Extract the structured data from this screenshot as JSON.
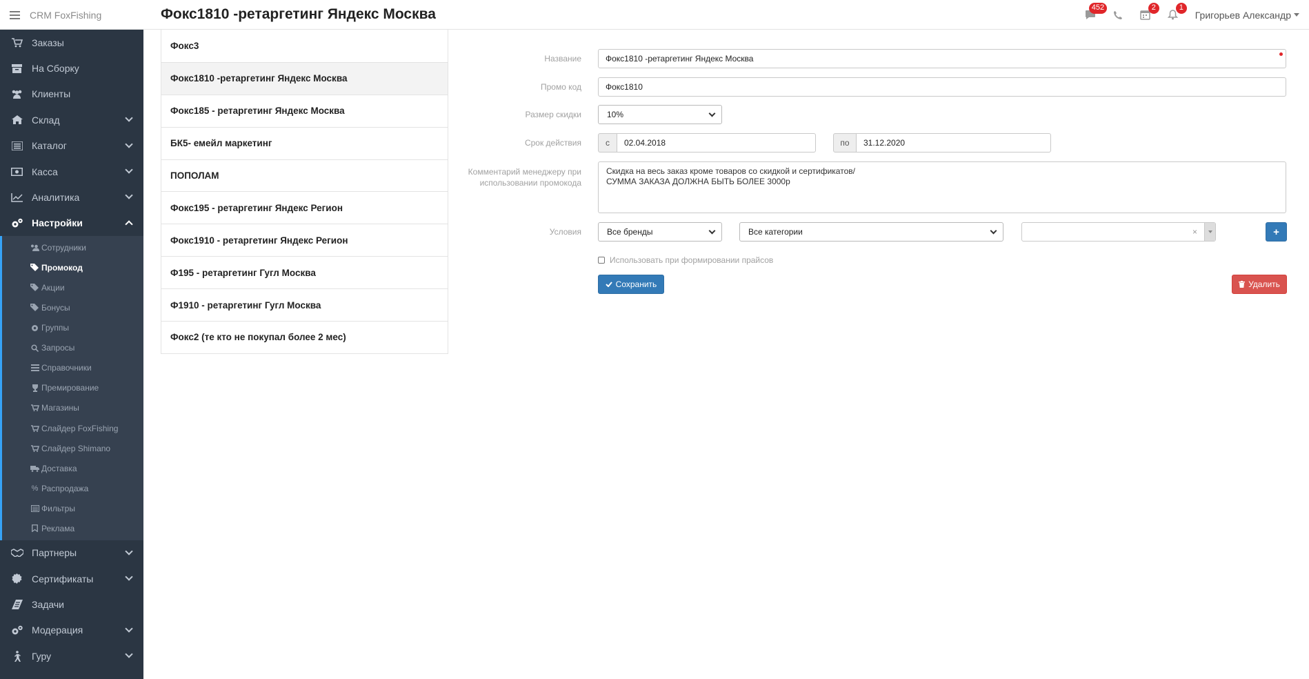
{
  "app": {
    "brand": "CRM FoxFishing",
    "page_title": "Фокс1810 -ретаргетинг Яндекс Москва"
  },
  "header": {
    "messages_count": "452",
    "calendar_count": "2",
    "notifications_count": "1",
    "user_name": "Григорьев Александр"
  },
  "sidebar": {
    "items": [
      {
        "label": "Заказы",
        "icon": "cart-icon"
      },
      {
        "label": "На Сборку",
        "icon": "box-icon"
      },
      {
        "label": "Клиенты",
        "icon": "users-icon"
      },
      {
        "label": "Склад",
        "icon": "home-icon"
      },
      {
        "label": "Каталог",
        "icon": "list-icon"
      },
      {
        "label": "Касса",
        "icon": "money-icon"
      },
      {
        "label": "Аналитика",
        "icon": "chart-icon"
      },
      {
        "label": "Настройки",
        "icon": "cogs-icon"
      }
    ],
    "sub_items": [
      {
        "label": "Сотрудники",
        "icon": "users-icon"
      },
      {
        "label": "Промокод",
        "icon": "tags-icon"
      },
      {
        "label": "Акции",
        "icon": "tags-icon"
      },
      {
        "label": "Бонусы",
        "icon": "tags-icon"
      },
      {
        "label": "Группы",
        "icon": "gear-icon"
      },
      {
        "label": "Запросы",
        "icon": "search-icon"
      },
      {
        "label": "Справочники",
        "icon": "list-icon"
      },
      {
        "label": "Премирование",
        "icon": "trophy-icon"
      },
      {
        "label": "Магазины",
        "icon": "cart-icon"
      },
      {
        "label": "Слайдер FoxFishing",
        "icon": "cart-icon"
      },
      {
        "label": "Слайдер Shimano",
        "icon": "cart-icon"
      },
      {
        "label": "Доставка",
        "icon": "truck-icon"
      },
      {
        "label": "Распродажа",
        "icon": "percent-icon"
      },
      {
        "label": "Фильтры",
        "icon": "list-icon"
      },
      {
        "label": "Реклама",
        "icon": "bookmark-icon"
      }
    ],
    "bottom_items": [
      {
        "label": "Партнеры",
        "icon": "handshake-icon"
      },
      {
        "label": "Сертификаты",
        "icon": "certificate-icon"
      },
      {
        "label": "Задачи",
        "icon": "tasks-icon"
      },
      {
        "label": "Модерация",
        "icon": "cogs-icon"
      },
      {
        "label": "Гуру",
        "icon": "walk-icon"
      }
    ]
  },
  "promo_list": [
    "Фокс3",
    "Фокс1810 -ретаргетинг Яндекс Москва",
    "Фокс185 - ретаргетинг Яндекс Москва",
    "БК5- емейл маркетинг",
    "ПОПОЛАМ",
    "Фокс195 - ретаргетинг Яндекс Регион",
    "Фокс1910 - ретаргетинг Яндекс Регион",
    "Ф195 - ретаргетинг Гугл Москва",
    "Ф1910 - ретаргетинг Гугл Москва",
    "Фокс2 (те кто не покупал более 2 мес)"
  ],
  "form": {
    "name_label": "Название",
    "name_value": "Фокс1810 -ретаргетинг Яндекс Москва",
    "code_label": "Промо код",
    "code_value": "Фокс1810",
    "discount_label": "Размер скидки",
    "discount_value": "10%",
    "validity_label": "Срок действия",
    "from_label": "с",
    "from_value": "02.04.2018",
    "to_label": "по",
    "to_value": "31.12.2020",
    "comment_label_1": "Комментарий менеджеру при",
    "comment_label_2": "использовании промокода",
    "comment_line_1": "Скидка на весь заказ кроме товаров со скидкой и сертификатов/",
    "comment_line_2": "СУММА ЗАКАЗА ДОЛЖНА БЫТЬ БОЛЕЕ 3000р",
    "conditions_label": "Условия",
    "brands_value": "Все бренды",
    "categories_value": "Все категории",
    "add_button": "+",
    "clear_mark": "×",
    "pricelist_checkbox_label": "Использовать при формировании прайсов",
    "save_button": "Сохранить",
    "delete_button": "Удалить"
  },
  "colors": {
    "sidebar_bg": "#2b3643",
    "accent_blue": "#337ab7",
    "danger_red": "#d9534f",
    "badge_red": "#e0262a"
  }
}
